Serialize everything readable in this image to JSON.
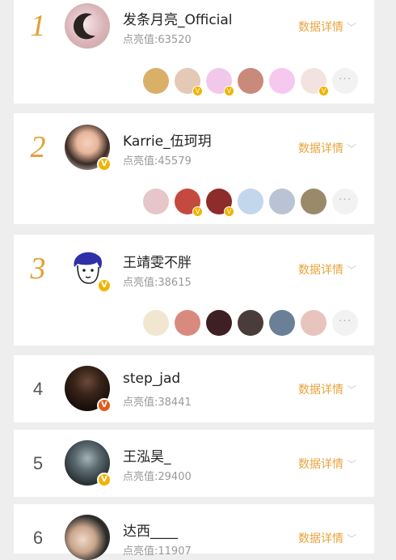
{
  "detail_label": "数据详情",
  "details_chevron": "chevron-down-icon",
  "more_label": "···",
  "verified_badge": "V",
  "colors": {
    "accent": "#e8a33c",
    "rank_top": "#e2a033",
    "verified": "#f0b400",
    "red_badge": "#e25a1c"
  },
  "entries": [
    {
      "rank": "1",
      "name": "发条月亮_Official",
      "points": "点亮值:63520"
    },
    {
      "rank": "2",
      "name": "Karrie_伍珂玥",
      "points": "点亮值:45579"
    },
    {
      "rank": "3",
      "name": "王靖雯不胖",
      "points": "点亮值:38615"
    },
    {
      "rank": "4",
      "name": "step_jad",
      "points": "点亮值:38441"
    },
    {
      "rank": "5",
      "name": "王泓昊_",
      "points": "点亮值:29400"
    },
    {
      "rank": "6",
      "name": "达西____",
      "points": "点亮值:11907"
    }
  ]
}
